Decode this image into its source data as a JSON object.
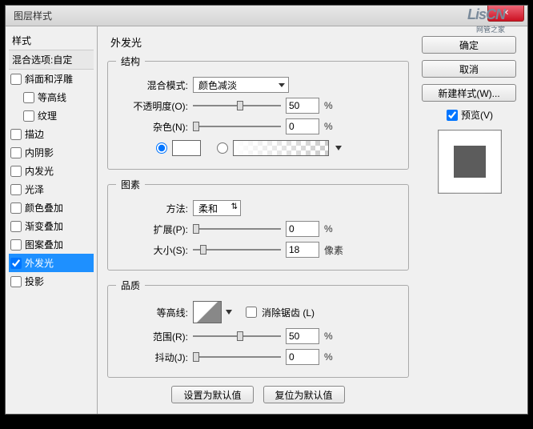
{
  "window_title": "图层样式",
  "sidebar": {
    "header": "样式",
    "subheader": "混合选项:自定",
    "items": [
      {
        "label": "斜面和浮雕",
        "checked": false,
        "indent": false
      },
      {
        "label": "等高线",
        "checked": false,
        "indent": true
      },
      {
        "label": "纹理",
        "checked": false,
        "indent": true
      },
      {
        "label": "描边",
        "checked": false,
        "indent": false
      },
      {
        "label": "内阴影",
        "checked": false,
        "indent": false
      },
      {
        "label": "内发光",
        "checked": false,
        "indent": false
      },
      {
        "label": "光泽",
        "checked": false,
        "indent": false
      },
      {
        "label": "颜色叠加",
        "checked": false,
        "indent": false
      },
      {
        "label": "渐变叠加",
        "checked": false,
        "indent": false
      },
      {
        "label": "图案叠加",
        "checked": false,
        "indent": false
      },
      {
        "label": "外发光",
        "checked": true,
        "indent": false,
        "selected": true
      },
      {
        "label": "投影",
        "checked": false,
        "indent": false
      }
    ]
  },
  "panel": {
    "title": "外发光",
    "structure_legend": "结构",
    "blend_mode_label": "混合模式:",
    "blend_mode_value": "颜色减淡",
    "opacity_label": "不透明度(O):",
    "opacity_value": "50",
    "opacity_unit": "%",
    "noise_label": "杂色(N):",
    "noise_value": "0",
    "noise_unit": "%",
    "elements_legend": "图素",
    "technique_label": "方法:",
    "technique_value": "柔和",
    "spread_label": "扩展(P):",
    "spread_value": "0",
    "spread_unit": "%",
    "size_label": "大小(S):",
    "size_value": "18",
    "size_unit": "像素",
    "quality_legend": "品质",
    "contour_label": "等高线:",
    "antialias_label": "消除锯齿 (L)",
    "range_label": "范围(R):",
    "range_value": "50",
    "range_unit": "%",
    "jitter_label": "抖动(J):",
    "jitter_value": "0",
    "jitter_unit": "%",
    "default_btn": "设置为默认值",
    "reset_btn": "复位为默认值"
  },
  "right": {
    "ok": "确定",
    "cancel": "取消",
    "new_style": "新建样式(W)...",
    "preview": "预览(V)"
  },
  "watermark": "LisCN",
  "watermark_sub": "网管之家",
  "chart_data": {
    "type": "table",
    "title": "Layer Style — Outer Glow parameters",
    "series": [
      {
        "name": "Blend Mode",
        "value": "Color Dodge (颜色减淡)"
      },
      {
        "name": "Opacity",
        "value": 50,
        "unit": "%"
      },
      {
        "name": "Noise",
        "value": 0,
        "unit": "%"
      },
      {
        "name": "Color Source",
        "value": "solid white"
      },
      {
        "name": "Technique",
        "value": "Softer (柔和)"
      },
      {
        "name": "Spread",
        "value": 0,
        "unit": "%"
      },
      {
        "name": "Size",
        "value": 18,
        "unit": "px"
      },
      {
        "name": "Anti-aliased",
        "value": false
      },
      {
        "name": "Range",
        "value": 50,
        "unit": "%"
      },
      {
        "name": "Jitter",
        "value": 0,
        "unit": "%"
      }
    ]
  }
}
